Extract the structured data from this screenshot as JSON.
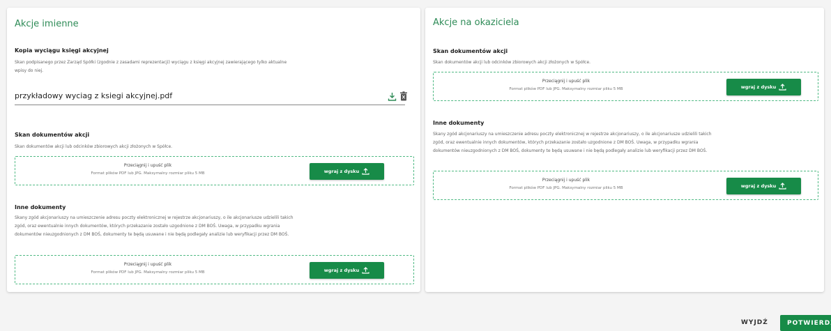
{
  "left_panel": {
    "title": "Akcje imienne",
    "extract": {
      "title": "Kopia wyciągu księgi akcyjnej",
      "description_line1": "Skan podpisanego przez Zarząd Spółki (zgodnie z zasadami reprezentacji) wyciągu z księgi akcyjnej zawierającego tylko aktualne",
      "description_line2": "wpisy do niej.",
      "file_name": "przykładowy wyciag z ksiegi akcyjnej.pdf"
    },
    "scan": {
      "title": "Skan dokumentów akcji",
      "description": "Skan dokumentów akcji lub odcinków zbiorowych akcji złożonych w Spółce.",
      "dropzone_main": "Przeciągnij i upuść plik",
      "dropzone_sub": "Format plików PDF lub JPG. Maksymalny rozmiar pliku 5 MB",
      "button": "wgraj z dysku"
    },
    "other": {
      "title": "Inne dokumenty",
      "description_line1": "Skany zgód akcjonariuszy na umieszczenie adresu poczty elektronicznej w rejestrze akcjonariuszy, o ile akcjonariusze udzielili takich",
      "description_line2": "zgód, oraz ewentualnie innych dokumentów, których przekazanie zostało uzgodnione z DM BOŚ. Uwaga, w przypadku wgrania",
      "description_line3": "dokumentów nieuzgodnionych z DM BOŚ, dokumenty te będą usuwane i nie będą podlegały analizie lub weryfikacji przez DM BOŚ.",
      "dropzone_main": "Przeciągnij i upuść plik",
      "dropzone_sub": "Format plików PDF lub JPG. Maksymalny rozmiar pliku 5 MB",
      "button": "wgraj z dysku"
    }
  },
  "right_panel": {
    "title": "Akcje na okaziciela",
    "scan": {
      "title": "Skan dokumentów akcji",
      "description": "Skan dokumentów akcji lub odcinków zbiorowych akcji złożonych w Spółce.",
      "dropzone_main": "Przeciągnij i upuść plik",
      "dropzone_sub": "Format plików PDF lub JPG. Maksymalny rozmiar pliku 5 MB",
      "button": "wgraj z dysku"
    },
    "other": {
      "title": "Inne dokumenty",
      "description_line1": "Skany zgód akcjonariuszy na umieszczenie adresu poczty elektronicznej w rejestrze akcjonariuszy, o ile akcjonariusze udzielili takich",
      "description_line2": "zgód, oraz ewentualnie innych dokumentów, których przekazanie zostało uzgodnione z DM BOŚ. Uwaga, w przypadku wgrania",
      "description_line3": "dokumentów nieuzgodnionych z DM BOŚ, dokumenty te będą usuwane i nie będą podlegały analizie lub weryfikacji przez DM BOŚ.",
      "dropzone_main": "Przeciągnij i upuść plik",
      "dropzone_sub": "Format plików PDF lub JPG. Maksymalny rozmiar pliku 5 MB",
      "button": "wgraj z dysku"
    }
  },
  "footer": {
    "exit_label": "WYJDŹ",
    "confirm_label": "POTWIERDŹ"
  },
  "colors": {
    "accent": "#178b48",
    "title_green": "#2e8b57",
    "dropzone_border": "#4fb983"
  },
  "icons": {
    "upload": "upload-icon",
    "download": "download-icon",
    "delete": "trash-icon"
  }
}
